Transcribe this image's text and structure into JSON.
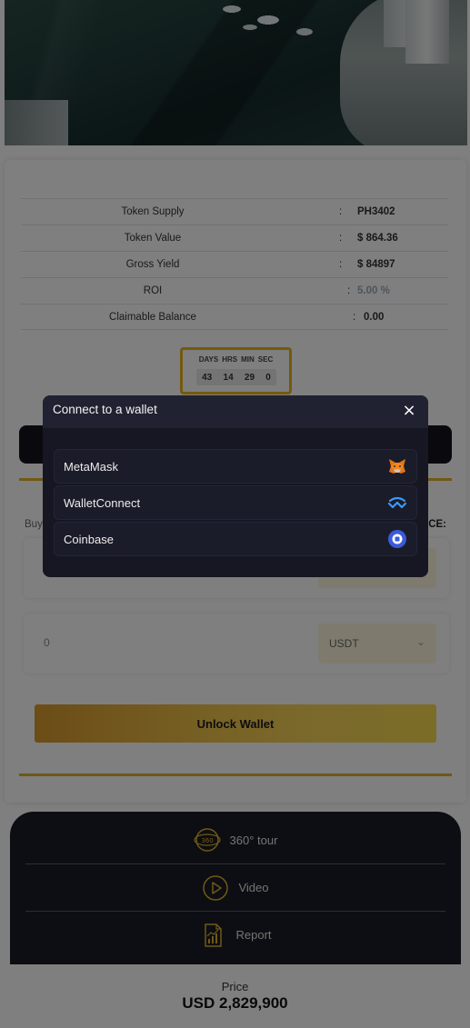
{
  "stats": [
    {
      "label": "Token Supply",
      "value": "PH3402"
    },
    {
      "label": "Token Value",
      "value": "$ 864.36"
    },
    {
      "label": "Gross Yield",
      "value": "$ 84897"
    },
    {
      "label": "ROI",
      "value": "5.00 %"
    },
    {
      "label": "Claimable Balance",
      "value": "0.00"
    }
  ],
  "stat_separator": ":",
  "countdown": {
    "labels": [
      "DAYS",
      "HRS",
      "MIN",
      "SEC"
    ],
    "values": [
      "43",
      "14",
      "29",
      "0"
    ]
  },
  "buy": {
    "label": "Buy",
    "price_label": "CE:",
    "amount_value": "0",
    "currency": "USDT"
  },
  "unlock_button": "Unlock Wallet",
  "media": {
    "items": [
      {
        "label": "360° tour",
        "icon": "360-tour-icon"
      },
      {
        "label": "Video",
        "icon": "play-icon"
      },
      {
        "label": "Report",
        "icon": "report-icon"
      }
    ]
  },
  "price": {
    "caption": "Price",
    "value": "USD 2,829,900"
  },
  "modal": {
    "title": "Connect to a wallet",
    "close_symbol": "×",
    "wallets": [
      {
        "name": "MetaMask",
        "icon": "metamask-fox-icon"
      },
      {
        "name": "WalletConnect",
        "icon": "walletconnect-icon"
      },
      {
        "name": "Coinbase",
        "icon": "coinbase-icon"
      }
    ]
  },
  "colors": {
    "accent_gold": "#e0b12a",
    "dark_panel": "#1a1c26",
    "modal_bg": "#161722",
    "coinbase_blue": "#3b5bdb",
    "walletconnect_blue": "#3b99fc"
  }
}
